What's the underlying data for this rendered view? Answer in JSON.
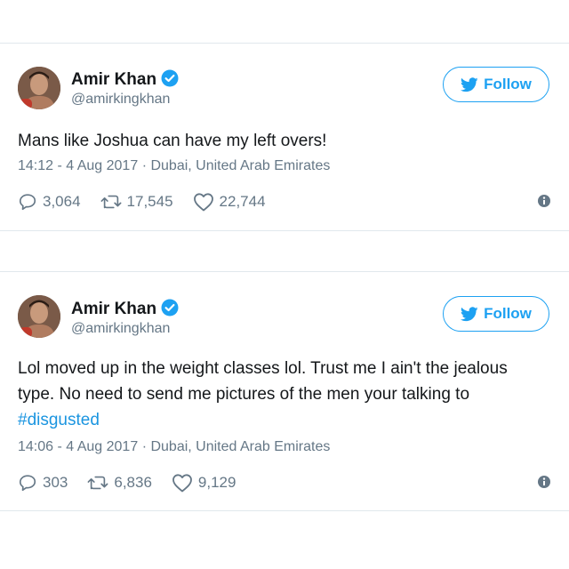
{
  "colors": {
    "accent": "#1da1f2",
    "hashtag": "#1b95e0",
    "secondary_text": "#657786",
    "primary_text": "#14171a",
    "divider": "#e1e8ed"
  },
  "tweets": [
    {
      "user": {
        "name": "Amir Khan",
        "handle": "@amirkingkhan",
        "verified": true
      },
      "follow_label": "Follow",
      "text": "Mans like Joshua can have my left overs!",
      "timestamp": "14:12 - 4 Aug 2017",
      "location": "Dubai, United Arab Emirates",
      "meta_separator": "·",
      "replies": "3,064",
      "retweets": "17,545",
      "likes": "22,744",
      "icons": [
        "reply-icon",
        "retweet-icon",
        "like-icon",
        "info-icon"
      ]
    },
    {
      "user": {
        "name": "Amir Khan",
        "handle": "@amirkingkhan",
        "verified": true
      },
      "follow_label": "Follow",
      "text": "Lol moved up in the weight classes lol. Trust me I ain't the jealous type. No need to send me pictures of the men your talking to ",
      "hashtag": "#disgusted",
      "timestamp": "14:06 - 4 Aug 2017",
      "location": "Dubai, United Arab Emirates",
      "meta_separator": "·",
      "replies": "303",
      "retweets": "6,836",
      "likes": "9,129",
      "icons": [
        "reply-icon",
        "retweet-icon",
        "like-icon",
        "info-icon"
      ]
    }
  ]
}
